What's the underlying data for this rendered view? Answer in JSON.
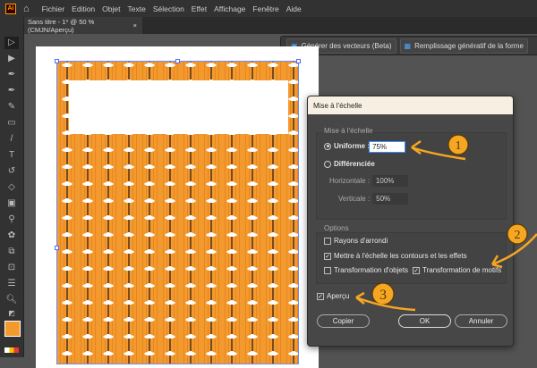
{
  "app": {
    "logo": "Ai",
    "home_icon": "home-icon"
  },
  "menu": [
    "Fichier",
    "Edition",
    "Objet",
    "Texte",
    "Sélection",
    "Effet",
    "Affichage",
    "Fenêtre",
    "Aide"
  ],
  "document_tab": {
    "title": "Sans titre - 1* @ 50 % (CMJN/Aperçu)",
    "close": "×"
  },
  "context_bar": {
    "generate_vectors": "Générer des vecteurs (Beta)",
    "generative_fill": "Remplissage génératif de la forme"
  },
  "dialog": {
    "title": "Mise à l'échelle",
    "scale_group": "Mise à l'échelle",
    "uniform_label": "Uniforme :",
    "uniform_value": "75%",
    "non_uniform_label": "Différenciée",
    "horizontal_label": "Horizontale :",
    "horizontal_value": "100%",
    "vertical_label": "Verticale :",
    "vertical_value": "50%",
    "options_group": "Options",
    "scale_corners": "Rayons d'arrondi",
    "scale_strokes": "Mettre à l'échelle les contours et les effets",
    "transform_objects": "Transformation d'objets",
    "transform_patterns": "Transformation de motifs",
    "preview": "Aperçu",
    "copy": "Copier",
    "ok": "OK",
    "cancel": "Annuler"
  },
  "annotations": [
    "1",
    "2",
    "3"
  ],
  "colors": {
    "accent": "#f5a623",
    "pattern": "#f39a2e"
  }
}
